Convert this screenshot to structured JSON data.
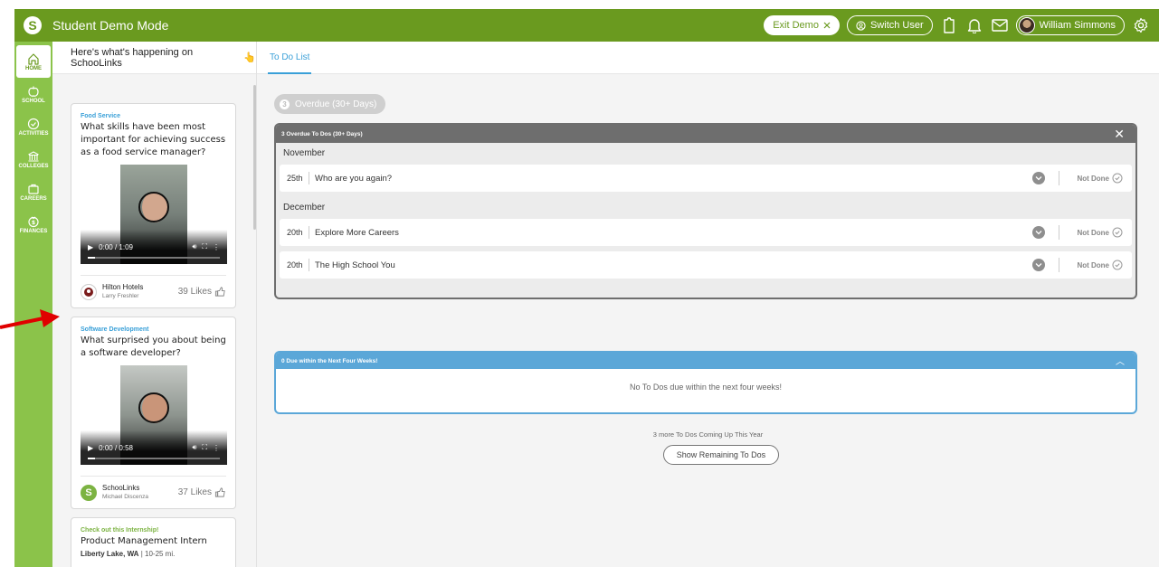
{
  "app": {
    "title": "Student Demo Mode",
    "logo_letter": "S",
    "accent": "#6a9a1f",
    "sidebar_color": "#8bc34a"
  },
  "topbar": {
    "exit_demo": "Exit Demo",
    "switch_user": "Switch User",
    "user_name": "William Simmons",
    "icons": [
      "clipboard-icon",
      "bell-icon",
      "mail-icon",
      "gear-icon"
    ]
  },
  "sidebar": {
    "items": [
      {
        "label": "HOME",
        "icon": "home-icon"
      },
      {
        "label": "SCHOOL",
        "icon": "apple-icon"
      },
      {
        "label": "ACTIVITIES",
        "icon": "check-circle-icon"
      },
      {
        "label": "COLLEGES",
        "icon": "building-icon"
      },
      {
        "label": "CAREERS",
        "icon": "briefcase-icon"
      },
      {
        "label": "FINANCES",
        "icon": "money-icon"
      }
    ]
  },
  "feed": {
    "header": "Here's what's happening on SchooLinks",
    "header_emoji": "👆",
    "cards": [
      {
        "category": "Food Service",
        "title": "What skills have been most important for achieving success as a food service manager?",
        "time": "0:00 / 1:09",
        "org": "Hilton Hotels",
        "person": "Larry Freshler",
        "likes": "39 Likes"
      },
      {
        "category": "Software Development",
        "title": "What surprised you about being a software developer?",
        "time": "0:00 / 0:58",
        "org": "SchooLinks",
        "person": "Michael Discenza",
        "likes": "37 Likes"
      },
      {
        "category": "Check out this Internship!",
        "title": "Product Management Intern",
        "location": "Liberty Lake, WA",
        "distance": "10-25 mi."
      }
    ]
  },
  "main": {
    "tab": "To Do List",
    "overdue_chip": "Overdue (30+ Days)",
    "overdue_chip_count": "3",
    "overdue_panel": {
      "title": "3 Overdue To Dos (30+ Days)",
      "groups": [
        {
          "month": "November",
          "items": [
            {
              "day": "25th",
              "title": "Who are you again?",
              "status": "Not Done"
            }
          ]
        },
        {
          "month": "December",
          "items": [
            {
              "day": "20th",
              "title": "Explore More Careers",
              "status": "Not Done"
            },
            {
              "day": "20th",
              "title": "The High School You",
              "status": "Not Done"
            }
          ]
        }
      ]
    },
    "due_panel": {
      "title": "0 Due within the Next Four Weeks!",
      "empty": "No To Dos due within the next four weeks!"
    },
    "more_text": "3 more To Dos Coming Up This Year",
    "show_button": "Show Remaining To Dos"
  }
}
